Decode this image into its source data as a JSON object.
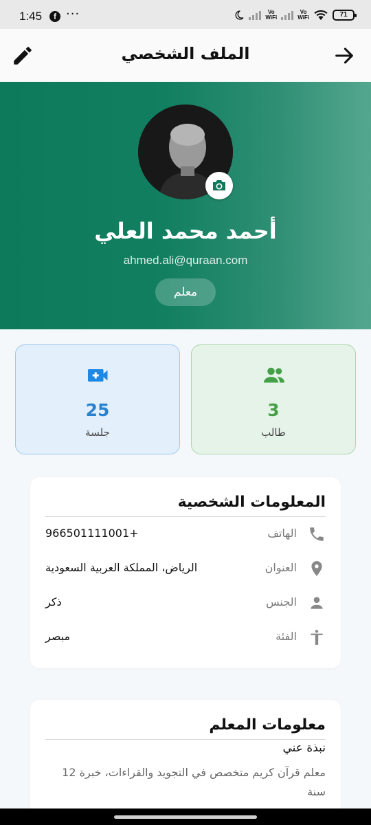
{
  "status_bar": {
    "time": "1:45",
    "battery": "71",
    "vowifi": "Vo\nWiFi"
  },
  "app_bar": {
    "title": "الملف الشخصي"
  },
  "profile": {
    "name": "أحمد محمد العلي",
    "email": "ahmed.ali@quraan.com",
    "role": "معلم"
  },
  "stats": {
    "sessions": {
      "value": "25",
      "label": "جلسة",
      "icon": "video-camera-icon"
    },
    "students": {
      "value": "3",
      "label": "طالب",
      "icon": "people-icon"
    }
  },
  "personal_info": {
    "title": "المعلومات الشخصية",
    "phone": {
      "label": "الهاتف",
      "value": "966501111001+"
    },
    "address": {
      "label": "العنوان",
      "value": "الرياض، المملكة العربية السعودية"
    },
    "gender": {
      "label": "الجنس",
      "value": "ذكر"
    },
    "category": {
      "label": "الفئة",
      "value": "مبصر"
    }
  },
  "teacher_info": {
    "title": "معلومات المعلم",
    "about_label": "نبذة عني",
    "about_text": "معلم قرآن كريم متخصص في التجويد والقراءات، خبرة 12 سنة"
  },
  "colors": {
    "primary": "#0d7a5c",
    "sessions_accent": "#2a82cf",
    "students_accent": "#43a047",
    "sessions_bg": "#e3f0fc",
    "students_bg": "#e6f3e8"
  }
}
